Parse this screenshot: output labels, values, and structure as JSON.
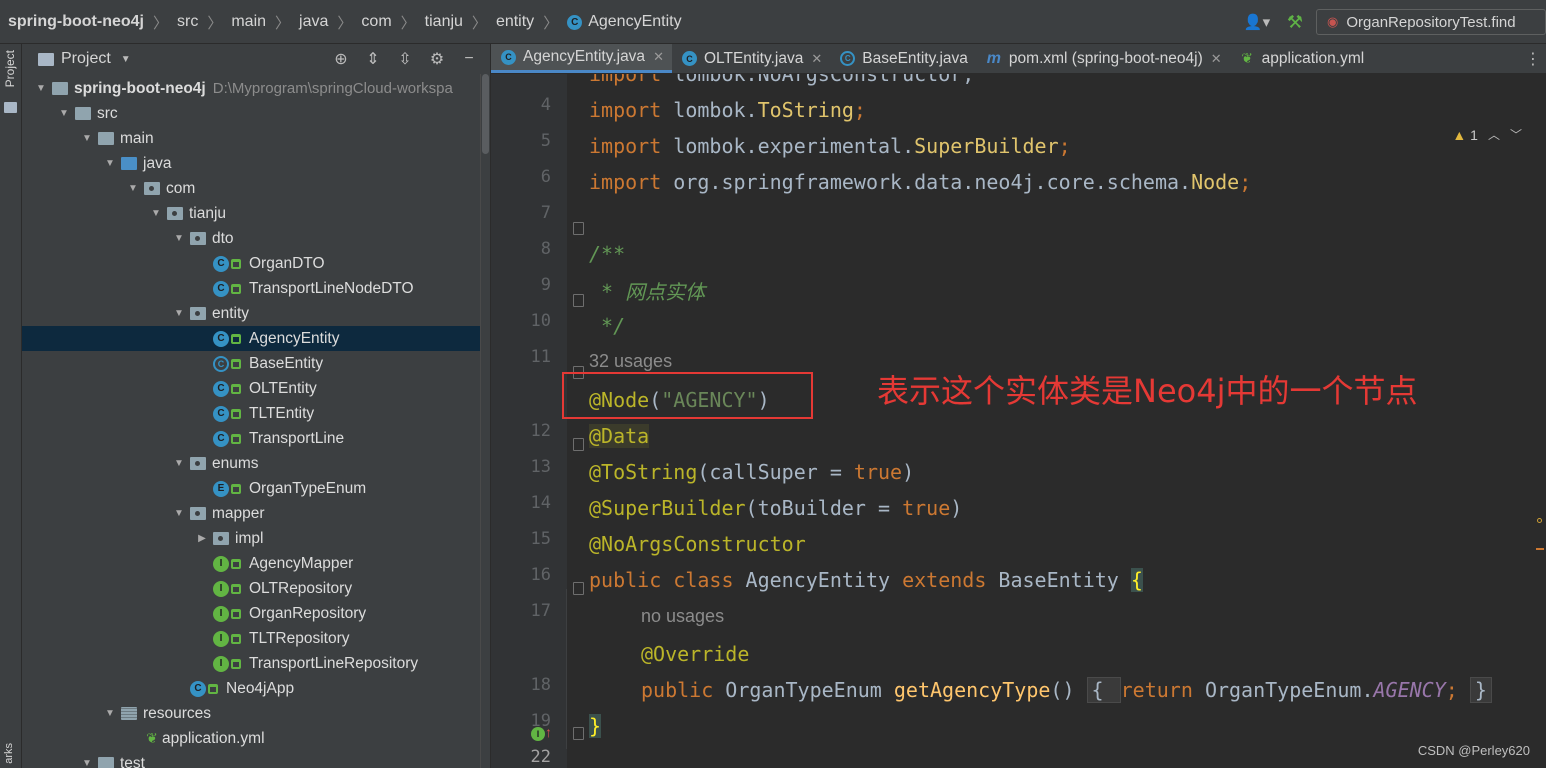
{
  "breadcrumb": {
    "items": [
      "spring-boot-neo4j",
      "src",
      "main",
      "java",
      "com",
      "tianju",
      "entity",
      "AgencyEntity"
    ]
  },
  "toolbar": {
    "run_config": "OrganRepositoryTest.find",
    "icons": [
      "user-icon",
      "hammer-icon"
    ]
  },
  "left_stripe": {
    "top_label": "Project",
    "bottom_label": "arks"
  },
  "project_panel": {
    "title": "Project",
    "tools": [
      "target-icon",
      "expand-all-icon",
      "collapse-all-icon",
      "gear-icon",
      "minimize-icon"
    ],
    "tree": [
      {
        "label": "spring-boot-neo4j",
        "path": "D:\\Myprogram\\springCloud-workspa",
        "kind": "module",
        "depth": 0,
        "expanded": true,
        "bold": true
      },
      {
        "label": "src",
        "kind": "folder",
        "depth": 1,
        "expanded": true
      },
      {
        "label": "main",
        "kind": "folder",
        "depth": 2,
        "expanded": true
      },
      {
        "label": "java",
        "kind": "source-folder",
        "depth": 3,
        "expanded": true
      },
      {
        "label": "com",
        "kind": "package",
        "depth": 4,
        "expanded": true
      },
      {
        "label": "tianju",
        "kind": "package",
        "depth": 5,
        "expanded": true
      },
      {
        "label": "dto",
        "kind": "package",
        "depth": 6,
        "expanded": true
      },
      {
        "label": "OrganDTO",
        "kind": "class",
        "depth": 7
      },
      {
        "label": "TransportLineNodeDTO",
        "kind": "class",
        "depth": 7
      },
      {
        "label": "entity",
        "kind": "package",
        "depth": 6,
        "expanded": true
      },
      {
        "label": "AgencyEntity",
        "kind": "class",
        "depth": 7,
        "selected": true
      },
      {
        "label": "BaseEntity",
        "kind": "abstract",
        "depth": 7
      },
      {
        "label": "OLTEntity",
        "kind": "class",
        "depth": 7
      },
      {
        "label": "TLTEntity",
        "kind": "class",
        "depth": 7
      },
      {
        "label": "TransportLine",
        "kind": "class",
        "depth": 7
      },
      {
        "label": "enums",
        "kind": "package",
        "depth": 6,
        "expanded": true
      },
      {
        "label": "OrganTypeEnum",
        "kind": "enum",
        "depth": 7
      },
      {
        "label": "mapper",
        "kind": "package",
        "depth": 6,
        "expanded": true
      },
      {
        "label": "impl",
        "kind": "package",
        "depth": 7,
        "expanded": false
      },
      {
        "label": "AgencyMapper",
        "kind": "interface",
        "depth": 7
      },
      {
        "label": "OLTRepository",
        "kind": "interface",
        "depth": 7
      },
      {
        "label": "OrganRepository",
        "kind": "interface",
        "depth": 7
      },
      {
        "label": "TLTRepository",
        "kind": "interface",
        "depth": 7
      },
      {
        "label": "TransportLineRepository",
        "kind": "interface",
        "depth": 7
      },
      {
        "label": "Neo4jApp",
        "kind": "app",
        "depth": 6
      },
      {
        "label": "resources",
        "kind": "resources",
        "depth": 3,
        "expanded": true
      },
      {
        "label": "application.yml",
        "kind": "yml",
        "depth": 4
      },
      {
        "label": "test",
        "kind": "folder",
        "depth": 2,
        "expanded": true
      }
    ]
  },
  "editor": {
    "tabs": [
      {
        "label": "AgencyEntity.java",
        "icon": "class",
        "active": true,
        "closable": true
      },
      {
        "label": "OLTEntity.java",
        "icon": "class",
        "active": false,
        "closable": true
      },
      {
        "label": "BaseEntity.java",
        "icon": "abstract",
        "active": false,
        "closable": false
      },
      {
        "label": "pom.xml (spring-boot-neo4j)",
        "icon": "maven",
        "active": false,
        "closable": true
      },
      {
        "label": "application.yml",
        "icon": "yml",
        "active": false,
        "closable": false
      }
    ],
    "inspection": {
      "warning_count": "1"
    },
    "gutter": {
      "line_numbers": [
        "4",
        "5",
        "6",
        "7",
        "8",
        "9",
        "10",
        "11",
        "12",
        "13",
        "14",
        "15",
        "16",
        "17",
        "18",
        "19",
        "22"
      ],
      "marker_label": "I"
    },
    "code": {
      "l4": [
        "import ",
        "lombok.NoArgsConstructor;"
      ],
      "l5": [
        "import ",
        "lombok.",
        "ToString",
        ";"
      ],
      "l6": [
        "import ",
        "lombok.experimental.",
        "SuperBuilder",
        ";"
      ],
      "l7": [
        "import ",
        "org.springframework.data.neo4j.core.schema.",
        "Node",
        ";"
      ],
      "l9": "/**",
      "l10": " * 网点实体",
      "l11": " */",
      "hint_usages": "32 usages",
      "l12": [
        "@Node",
        "(",
        "\"AGENCY\"",
        ")"
      ],
      "l13": "@Data",
      "l14": [
        "@ToString",
        "(callSuper = ",
        "true",
        ")"
      ],
      "l15": [
        "@SuperBuilder",
        "(toBuilder = ",
        "true",
        ")"
      ],
      "l16": "@NoArgsConstructor",
      "l17": [
        "public ",
        "class ",
        "AgencyEntity ",
        "extends ",
        "BaseEntity ",
        "{"
      ],
      "hint_no_usages": "no usages",
      "l18": "@Override",
      "l19": [
        "public ",
        "OrganTypeEnum ",
        "getAgencyType",
        "() ",
        "{ ",
        "return ",
        "OrganTypeEnum.",
        "AGENCY",
        "; ",
        "}"
      ],
      "l22": "}"
    }
  },
  "annotation": {
    "callout_text": "表示这个实体类是Neo4j中的一个节点",
    "callout_color": "#e53935"
  },
  "watermark": "CSDN @Perley620",
  "colors": {
    "keyword": "#cc7832",
    "annotation": "#bbb529",
    "string": "#6a8759",
    "comment": "#629755",
    "selection": "#0d293e",
    "editor_bg": "#2b2b2b"
  }
}
